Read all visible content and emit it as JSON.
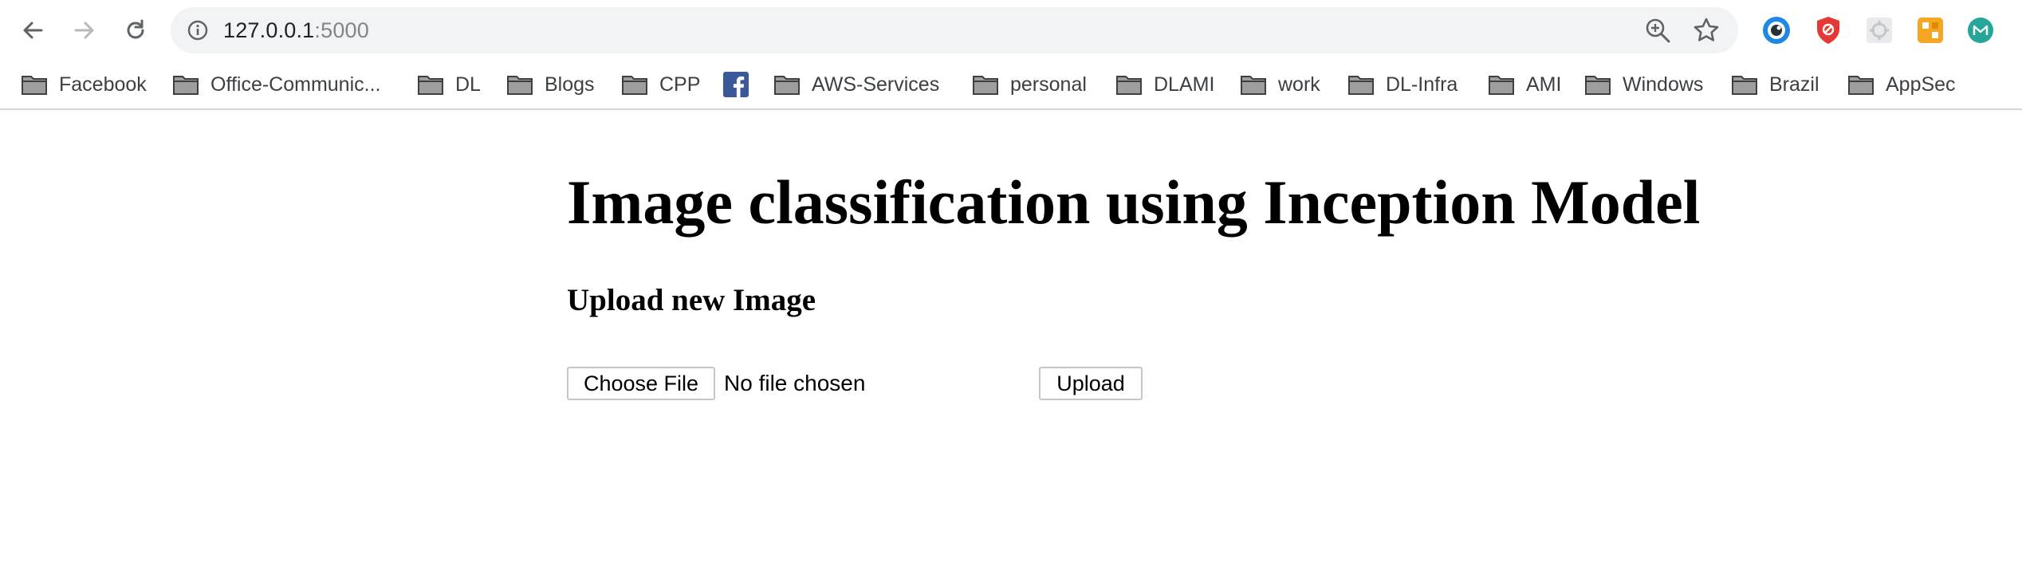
{
  "browser": {
    "url_host": "127.0.0.1",
    "url_port": ":5000",
    "icons": {
      "back": "back-arrow-icon",
      "forward": "forward-arrow-icon",
      "reload": "reload-icon",
      "info": "info-icon",
      "zoom": "zoom-icon",
      "bookmark_star": "star-icon"
    },
    "extensions": [
      "extension-blue-eye-icon",
      "extension-red-shield-icon",
      "extension-gray-gear-icon",
      "extension-orange-grid-icon",
      "extension-green-m-icon"
    ]
  },
  "bookmarks": [
    {
      "label": "Facebook",
      "icon": "folder-icon"
    },
    {
      "label": "Office-Communic...",
      "icon": "folder-icon"
    },
    {
      "label": "DL",
      "icon": "folder-icon"
    },
    {
      "label": "Blogs",
      "icon": "folder-icon"
    },
    {
      "label": "CPP",
      "icon": "folder-icon"
    },
    {
      "label": "",
      "icon": "facebook-icon"
    },
    {
      "label": "AWS-Services",
      "icon": "folder-icon"
    },
    {
      "label": "personal",
      "icon": "folder-icon"
    },
    {
      "label": "DLAMI",
      "icon": "folder-icon"
    },
    {
      "label": "work",
      "icon": "folder-icon"
    },
    {
      "label": "DL-Infra",
      "icon": "folder-icon"
    },
    {
      "label": "AMI",
      "icon": "folder-icon"
    },
    {
      "label": "Windows",
      "icon": "folder-icon"
    },
    {
      "label": "Brazil",
      "icon": "folder-icon"
    },
    {
      "label": "AppSec",
      "icon": "folder-icon"
    }
  ],
  "page": {
    "title": "Image classification using Inception Model",
    "section_title": "Upload new Image",
    "choose_file_label": "Choose File",
    "file_status": "No file chosen",
    "upload_label": "Upload"
  },
  "colors": {
    "omnibox_bg": "#f1f3f4",
    "facebook_blue": "#3b5998"
  }
}
